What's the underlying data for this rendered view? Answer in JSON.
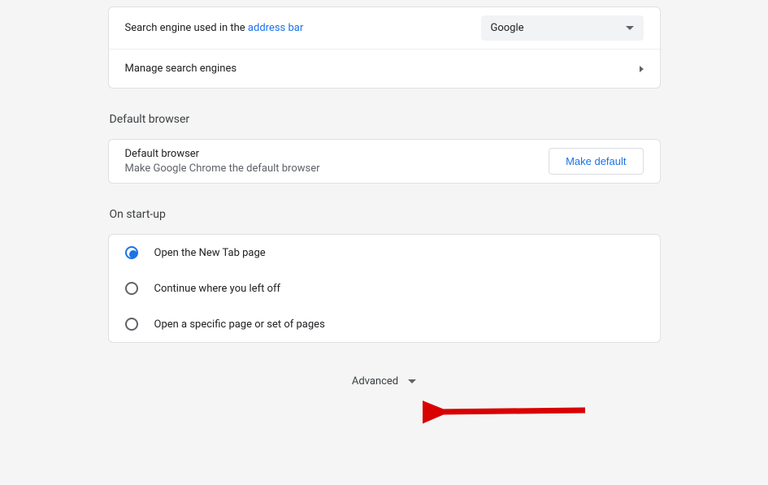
{
  "searchEngine": {
    "labelPrefix": "Search engine used in the ",
    "labelLink": "address bar",
    "selected": "Google",
    "manageLabel": "Manage search engines"
  },
  "defaultBrowser": {
    "sectionTitle": "Default browser",
    "title": "Default browser",
    "subtitle": "Make Google Chrome the default browser",
    "button": "Make default"
  },
  "onStartup": {
    "sectionTitle": "On start-up",
    "options": [
      "Open the New Tab page",
      "Continue where you left off",
      "Open a specific page or set of pages"
    ],
    "selectedIndex": 0
  },
  "advanced": {
    "label": "Advanced"
  }
}
